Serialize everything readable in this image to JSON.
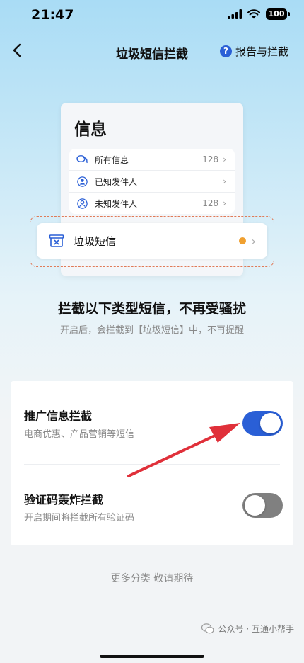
{
  "status_bar": {
    "time": "21:47",
    "battery": "100"
  },
  "nav": {
    "title": "垃圾短信拦截",
    "report_label": "报告与拦截",
    "help_glyph": "?"
  },
  "illustration": {
    "title": "信息",
    "rows": [
      {
        "label": "所有信息",
        "count": "128",
        "icon": "chat-bubbles-icon"
      },
      {
        "label": "已知发件人",
        "count": "",
        "icon": "known-person-icon"
      },
      {
        "label": "未知发件人",
        "count": "128",
        "icon": "unknown-person-icon"
      }
    ],
    "spam_label": "垃圾短信",
    "spam_dot_color": "#f0a030"
  },
  "headline": "拦截以下类型短信，不再受骚扰",
  "subline": "开启后，会拦截到【垃圾短信】中，不再提醒",
  "settings": [
    {
      "title": "推广信息拦截",
      "desc": "电商优惠、产品营销等短信",
      "enabled": true
    },
    {
      "title": "验证码轰炸拦截",
      "desc": "开启期间将拦截所有验证码",
      "enabled": false
    }
  ],
  "more_text": "更多分类 敬请期待",
  "watermark": "公众号 · 互通小帮手",
  "colors": {
    "accent": "#2a5fd6",
    "arrow": "#e0303a",
    "toggle_off": "#808080"
  }
}
